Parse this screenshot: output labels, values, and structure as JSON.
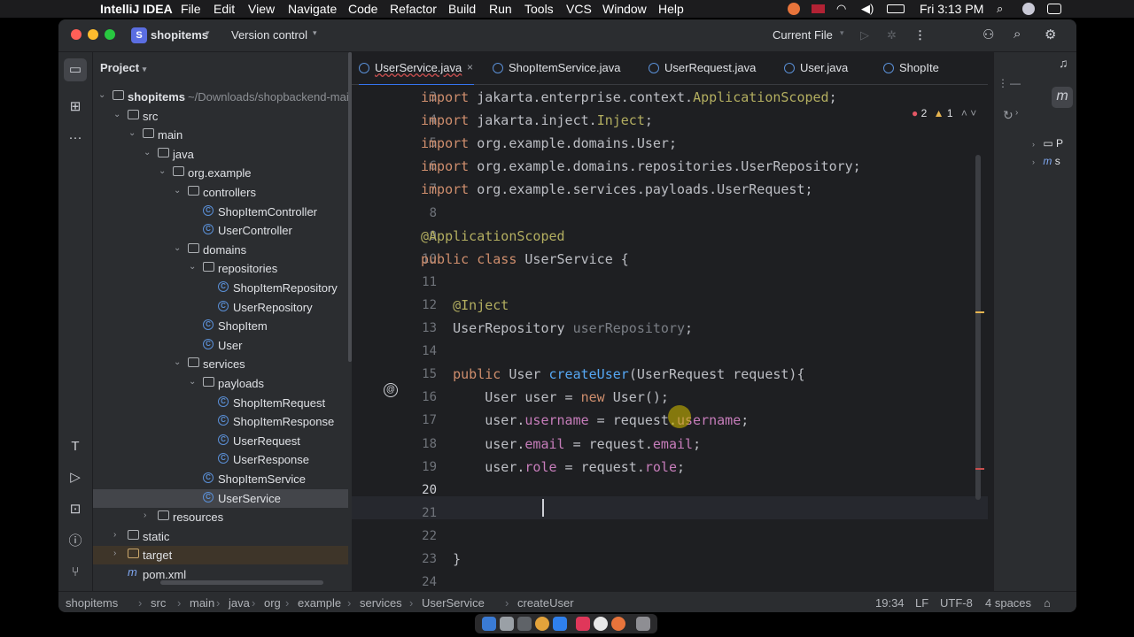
{
  "menubar": {
    "app_name": "IntelliJ IDEA",
    "items": [
      "File",
      "Edit",
      "View",
      "Navigate",
      "Code",
      "Refactor",
      "Build",
      "Run",
      "Tools",
      "VCS",
      "Window",
      "Help"
    ],
    "clock": "Fri 3:13 PM"
  },
  "titlebar": {
    "project_badge": "S",
    "project_name": "shopitems",
    "vcs_label": "Version control",
    "run_config": "Current File"
  },
  "project_panel": {
    "title": "Project",
    "root_name": "shopitems",
    "root_path": "~/Downloads/shopbackend-main/s",
    "tree": [
      {
        "label": "src",
        "depth": 1,
        "type": "folder",
        "expanded": true
      },
      {
        "label": "main",
        "depth": 2,
        "type": "folder",
        "expanded": true
      },
      {
        "label": "java",
        "depth": 3,
        "type": "folder",
        "expanded": true
      },
      {
        "label": "org.example",
        "depth": 4,
        "type": "package",
        "expanded": true
      },
      {
        "label": "controllers",
        "depth": 5,
        "type": "package",
        "expanded": true
      },
      {
        "label": "ShopItemController",
        "depth": 6,
        "type": "class"
      },
      {
        "label": "UserController",
        "depth": 6,
        "type": "class"
      },
      {
        "label": "domains",
        "depth": 5,
        "type": "package",
        "expanded": true
      },
      {
        "label": "repositories",
        "depth": 6,
        "type": "package",
        "expanded": true
      },
      {
        "label": "ShopItemRepository",
        "depth": 7,
        "type": "class"
      },
      {
        "label": "UserRepository",
        "depth": 7,
        "type": "class"
      },
      {
        "label": "ShopItem",
        "depth": 6,
        "type": "class"
      },
      {
        "label": "User",
        "depth": 6,
        "type": "class"
      },
      {
        "label": "services",
        "depth": 5,
        "type": "package",
        "expanded": true
      },
      {
        "label": "payloads",
        "depth": 6,
        "type": "package",
        "expanded": true
      },
      {
        "label": "ShopItemRequest",
        "depth": 7,
        "type": "class"
      },
      {
        "label": "ShopItemResponse",
        "depth": 7,
        "type": "class"
      },
      {
        "label": "UserRequest",
        "depth": 7,
        "type": "class"
      },
      {
        "label": "UserResponse",
        "depth": 7,
        "type": "class"
      },
      {
        "label": "ShopItemService",
        "depth": 6,
        "type": "class"
      },
      {
        "label": "UserService",
        "depth": 6,
        "type": "class",
        "selected": true
      },
      {
        "label": "resources",
        "depth": 3,
        "type": "folder",
        "expanded": false
      },
      {
        "label": "static",
        "depth": 1,
        "type": "folder",
        "expanded": false
      },
      {
        "label": "target",
        "depth": 1,
        "type": "folder",
        "expanded": false,
        "highlight": true
      },
      {
        "label": "pom.xml",
        "depth": 1,
        "type": "maven"
      }
    ]
  },
  "tabs": [
    {
      "label": "UserService.java",
      "active": true
    },
    {
      "label": "ShopItemService.java",
      "active": false
    },
    {
      "label": "UserRequest.java",
      "active": false
    },
    {
      "label": "User.java",
      "active": false
    },
    {
      "label": "ShopIte",
      "active": false
    }
  ],
  "inspections": {
    "errors": "2",
    "warnings": "1"
  },
  "code_lines": [
    {
      "n": "3",
      "tokens": [
        [
          "kw",
          "import "
        ],
        [
          "",
          "jakarta.enterprise.context."
        ],
        [
          "an",
          "ApplicationScoped"
        ],
        [
          "",
          ";"
        ]
      ]
    },
    {
      "n": "4",
      "tokens": [
        [
          "kw",
          "import "
        ],
        [
          "",
          "jakarta.inject."
        ],
        [
          "an",
          "Inject"
        ],
        [
          "",
          ";"
        ]
      ]
    },
    {
      "n": "5",
      "tokens": [
        [
          "kw",
          "import "
        ],
        [
          "",
          "org.example.domains.User;"
        ]
      ]
    },
    {
      "n": "6",
      "tokens": [
        [
          "kw",
          "import "
        ],
        [
          "",
          "org.example.domains.repositories.UserRepository;"
        ]
      ]
    },
    {
      "n": "7",
      "tokens": [
        [
          "kw",
          "import "
        ],
        [
          "",
          "org.example.services.payloads.UserRequest;"
        ]
      ]
    },
    {
      "n": "8",
      "tokens": []
    },
    {
      "n": "9",
      "tokens": [
        [
          "an",
          "@ApplicationScoped"
        ]
      ]
    },
    {
      "n": "10",
      "tokens": [
        [
          "kw",
          "public class "
        ],
        [
          "",
          "UserService {"
        ]
      ]
    },
    {
      "n": "11",
      "tokens": []
    },
    {
      "n": "12",
      "tokens": [
        [
          "",
          "    "
        ],
        [
          "an",
          "@Inject"
        ]
      ]
    },
    {
      "n": "13",
      "tokens": [
        [
          "",
          "    UserRepository "
        ],
        [
          "gray",
          "userRepository"
        ],
        [
          "",
          ";"
        ]
      ]
    },
    {
      "n": "14",
      "tokens": []
    },
    {
      "n": "15",
      "tokens": [
        [
          "",
          "    "
        ],
        [
          "kw",
          "public "
        ],
        [
          "",
          "User "
        ],
        [
          "fn",
          "createUser"
        ],
        [
          "",
          "(UserRequest request){"
        ]
      ]
    },
    {
      "n": "16",
      "tokens": [
        [
          "",
          "        User user = "
        ],
        [
          "kw",
          "new "
        ],
        [
          "",
          "User();"
        ]
      ]
    },
    {
      "n": "17",
      "tokens": [
        [
          "",
          "        user."
        ],
        [
          "fld",
          "username"
        ],
        [
          "",
          " = request."
        ],
        [
          "fld",
          "username"
        ],
        [
          "",
          ";"
        ]
      ]
    },
    {
      "n": "18",
      "tokens": [
        [
          "",
          "        user."
        ],
        [
          "fld",
          "email"
        ],
        [
          "",
          " = request."
        ],
        [
          "fld",
          "email"
        ],
        [
          "",
          ";"
        ]
      ]
    },
    {
      "n": "19",
      "tokens": [
        [
          "",
          "        user."
        ],
        [
          "fld",
          "role"
        ],
        [
          "",
          " = request."
        ],
        [
          "fld",
          "role"
        ],
        [
          "",
          ";"
        ]
      ]
    },
    {
      "n": "20",
      "tokens": []
    },
    {
      "n": "21",
      "tokens": []
    },
    {
      "n": "22",
      "tokens": []
    },
    {
      "n": "23",
      "tokens": [
        [
          "",
          "    }"
        ]
      ]
    },
    {
      "n": "24",
      "tokens": []
    }
  ],
  "statusbar": {
    "breadcrumb": [
      "shopitems",
      "src",
      "main",
      "java",
      "org",
      "example",
      "services",
      "UserService",
      "createUser"
    ],
    "position": "19:34",
    "line_sep": "LF",
    "encoding": "UTF-8",
    "indent": "4 spaces"
  },
  "right_panel": {
    "items": [
      "P",
      "s"
    ]
  },
  "colors": {
    "accent": "#3574f0",
    "keyword": "#cf8e6d",
    "annotation": "#b3ae60",
    "method": "#56a8f5",
    "field": "#c77dbb"
  }
}
